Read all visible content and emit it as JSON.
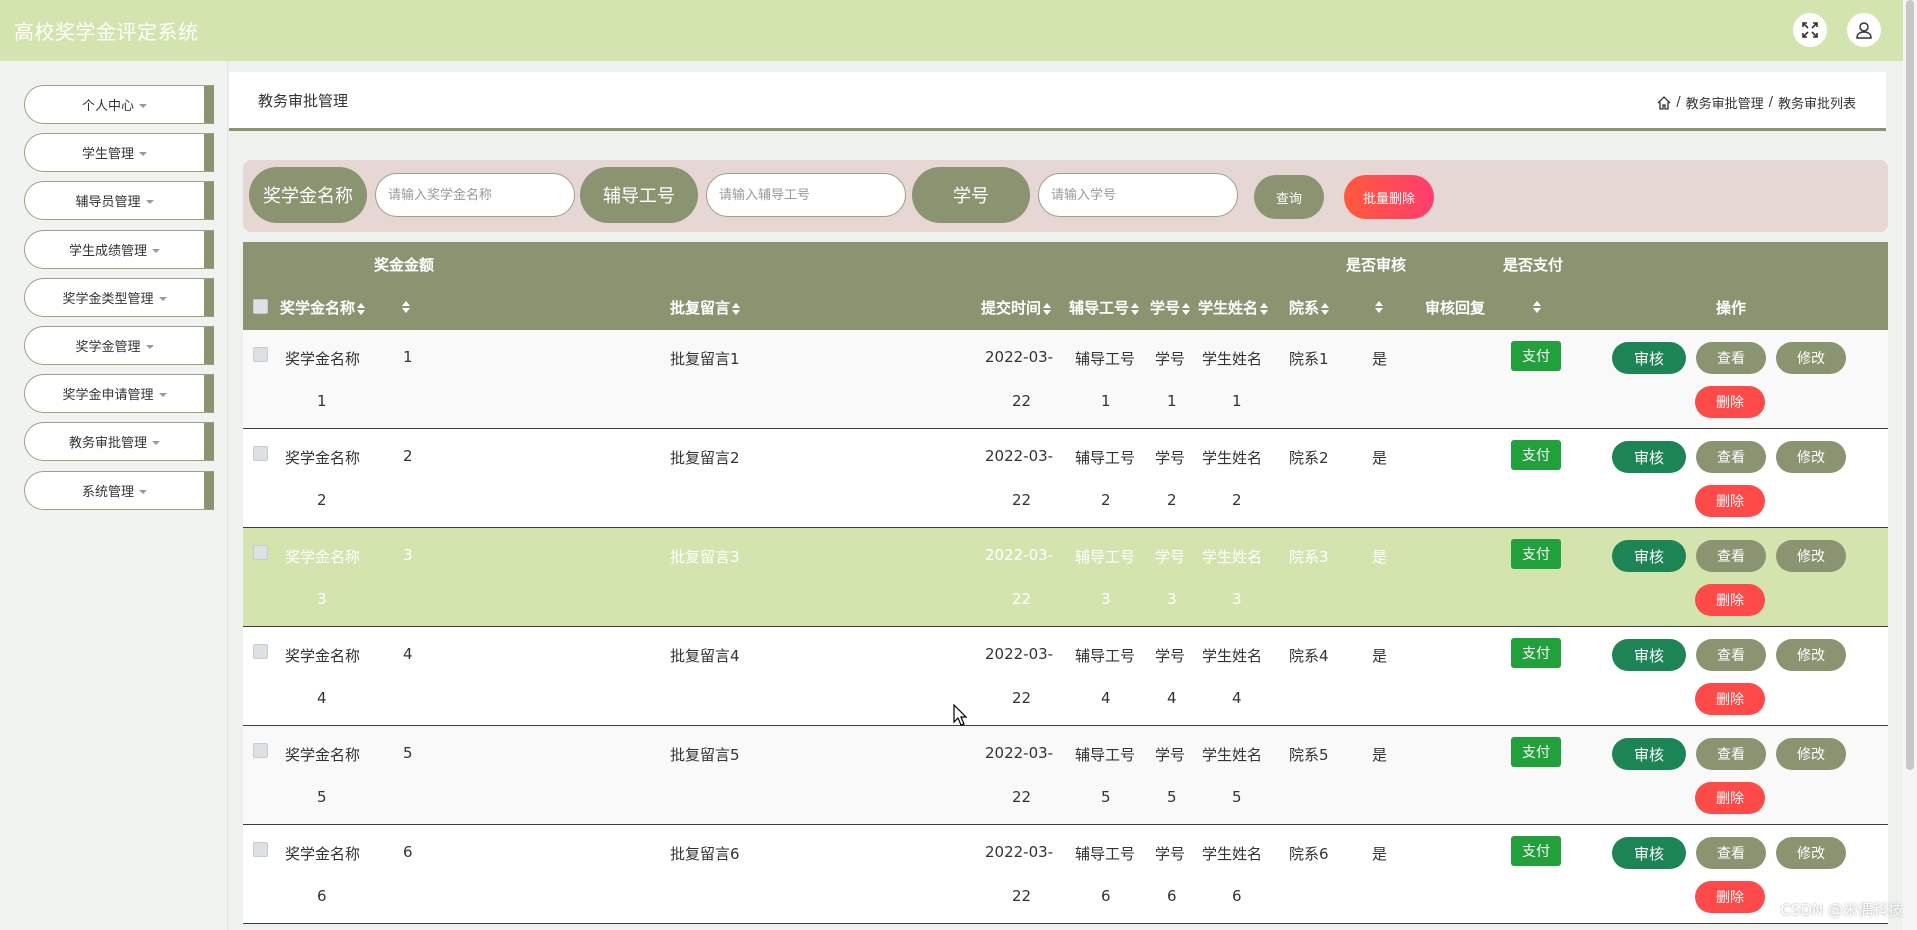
{
  "app": {
    "title": "高校奖学金评定系统"
  },
  "topbar": {
    "fullscreen_icon": "expand-icon",
    "user_icon": "user-icon"
  },
  "sidebar": {
    "items": [
      {
        "label": "个人中心"
      },
      {
        "label": "学生管理"
      },
      {
        "label": "辅导员管理"
      },
      {
        "label": "学生成绩管理"
      },
      {
        "label": "奖学金类型管理"
      },
      {
        "label": "奖学金管理"
      },
      {
        "label": "奖学金申请管理"
      },
      {
        "label": "教务审批管理"
      },
      {
        "label": "系统管理"
      }
    ]
  },
  "breadcrumb": {
    "page_title": "教务审批管理",
    "home_icon": "home-icon",
    "separator": "/",
    "level1": "教务审批管理",
    "level2": "教务审批列表"
  },
  "search": {
    "name_label": "奖学金名称",
    "name_placeholder": "请输入奖学金名称",
    "tutor_label": "辅导工号",
    "tutor_placeholder": "请输入辅导工号",
    "student_label": "学号",
    "student_placeholder": "请输入学号",
    "query_label": "查询",
    "bulk_delete_label": "批量删除"
  },
  "table": {
    "headers": {
      "amount": "奖金金额",
      "name": "奖学金名称",
      "reply": "批复留言",
      "submit_time": "提交时间",
      "tutor_no": "辅导工号",
      "student_no": "学号",
      "student_name": "学生姓名",
      "dept": "院系",
      "is_audit": "是否审核",
      "audit_reply": "审核回复",
      "is_paid": "是否支付",
      "actions": "操作"
    },
    "buttons": {
      "pay": "支付",
      "audit": "审核",
      "view": "查看",
      "edit": "修改",
      "delete": "删除"
    },
    "rows": [
      {
        "name1": "奖学金名称",
        "name2": "1",
        "amount": "1",
        "reply": "批复留言1",
        "time1": "2022-03-",
        "time2": "22",
        "tutor1": "辅导工号",
        "tutor2": "1",
        "sno1": "学号",
        "sno2": "1",
        "sname1": "学生姓名",
        "sname2": "1",
        "dept": "院系1",
        "audit": "是"
      },
      {
        "name1": "奖学金名称",
        "name2": "2",
        "amount": "2",
        "reply": "批复留言2",
        "time1": "2022-03-",
        "time2": "22",
        "tutor1": "辅导工号",
        "tutor2": "2",
        "sno1": "学号",
        "sno2": "2",
        "sname1": "学生姓名",
        "sname2": "2",
        "dept": "院系2",
        "audit": "是"
      },
      {
        "name1": "奖学金名称",
        "name2": "3",
        "amount": "3",
        "reply": "批复留言3",
        "time1": "2022-03-",
        "time2": "22",
        "tutor1": "辅导工号",
        "tutor2": "3",
        "sno1": "学号",
        "sno2": "3",
        "sname1": "学生姓名",
        "sname2": "3",
        "dept": "院系3",
        "audit": "是"
      },
      {
        "name1": "奖学金名称",
        "name2": "4",
        "amount": "4",
        "reply": "批复留言4",
        "time1": "2022-03-",
        "time2": "22",
        "tutor1": "辅导工号",
        "tutor2": "4",
        "sno1": "学号",
        "sno2": "4",
        "sname1": "学生姓名",
        "sname2": "4",
        "dept": "院系4",
        "audit": "是"
      },
      {
        "name1": "奖学金名称",
        "name2": "5",
        "amount": "5",
        "reply": "批复留言5",
        "time1": "2022-03-",
        "time2": "22",
        "tutor1": "辅导工号",
        "tutor2": "5",
        "sno1": "学号",
        "sno2": "5",
        "sname1": "学生姓名",
        "sname2": "5",
        "dept": "院系5",
        "audit": "是"
      },
      {
        "name1": "奖学金名称",
        "name2": "6",
        "amount": "6",
        "reply": "批复留言6",
        "time1": "2022-03-",
        "time2": "22",
        "tutor1": "辅导工号",
        "tutor2": "6",
        "sno1": "学号",
        "sno2": "6",
        "sname1": "学生姓名",
        "sname2": "6",
        "dept": "院系6",
        "audit": "是"
      }
    ]
  },
  "watermark": "CSDN @米偶科技",
  "colors": {
    "topbar": "#d4e4ae",
    "accent": "#8a9470",
    "audit_btn": "#1d8456",
    "pay_btn": "#22a03c",
    "delete_btn": "#ff4a4a",
    "highlight_row": "#d4e4ae"
  }
}
